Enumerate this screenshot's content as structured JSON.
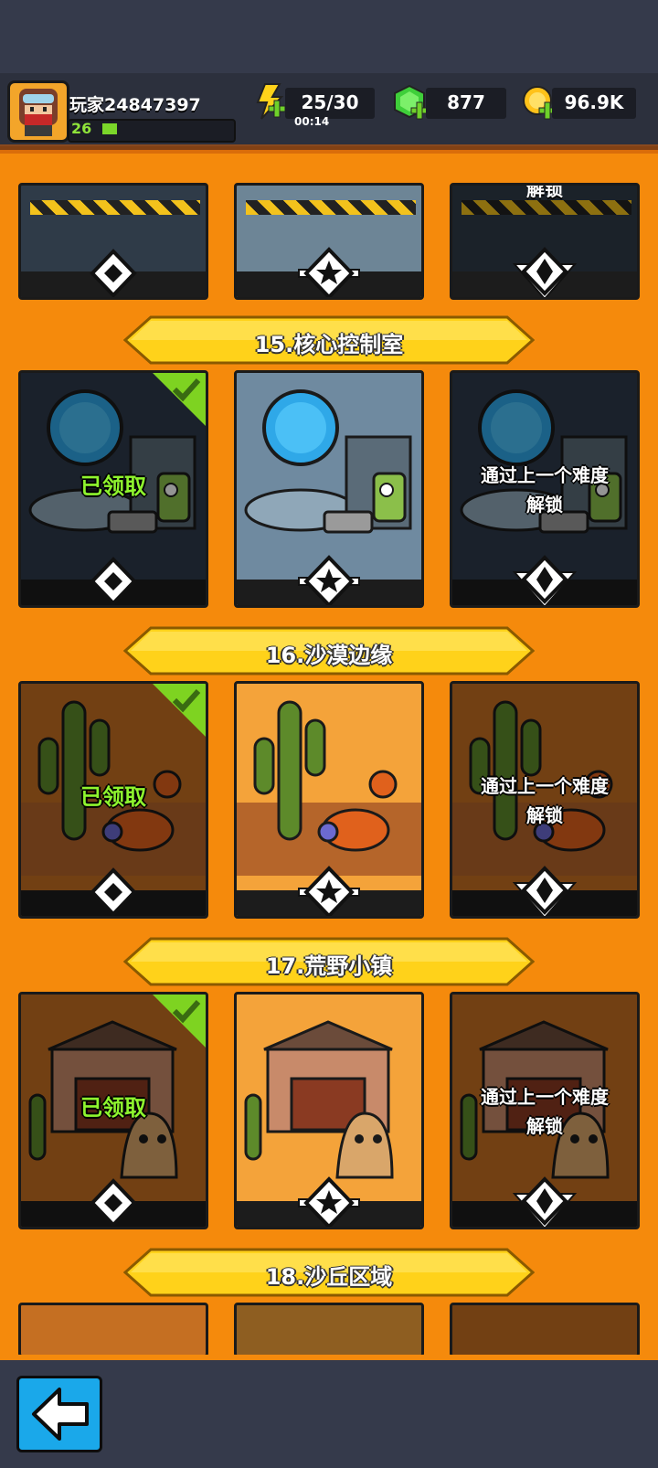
{
  "player": {
    "name": "玩家24847397",
    "level": "26",
    "xp_fraction": 0.1
  },
  "stats": {
    "energy": "25/30",
    "energy_timer": "00:14",
    "gems": "877",
    "coins": "96.9K"
  },
  "stages": [
    {
      "title": "15.核心控制室",
      "theme": "control-room"
    },
    {
      "title": "16.沙漠边缘",
      "theme": "desert"
    },
    {
      "title": "17.荒野小镇",
      "theme": "town"
    },
    {
      "title": "18.沙丘区域",
      "theme": "dune"
    }
  ],
  "card_labels": {
    "claimed": "已领取",
    "locked": "通过上一个难度解锁",
    "locked_line1": "通过上一个难度",
    "locked_line2": "解锁"
  },
  "top_partial_label": "解锁",
  "colors": {
    "accent": "#f58a0c",
    "banner": "#ffd21a",
    "claimed": "#8ff52e",
    "back_button": "#1aa8ea"
  },
  "icons": {
    "energy": "lightning-plus-icon",
    "gems": "green-gem-plus-icon",
    "coins": "gold-coin-plus-icon",
    "back": "back-arrow-icon"
  }
}
